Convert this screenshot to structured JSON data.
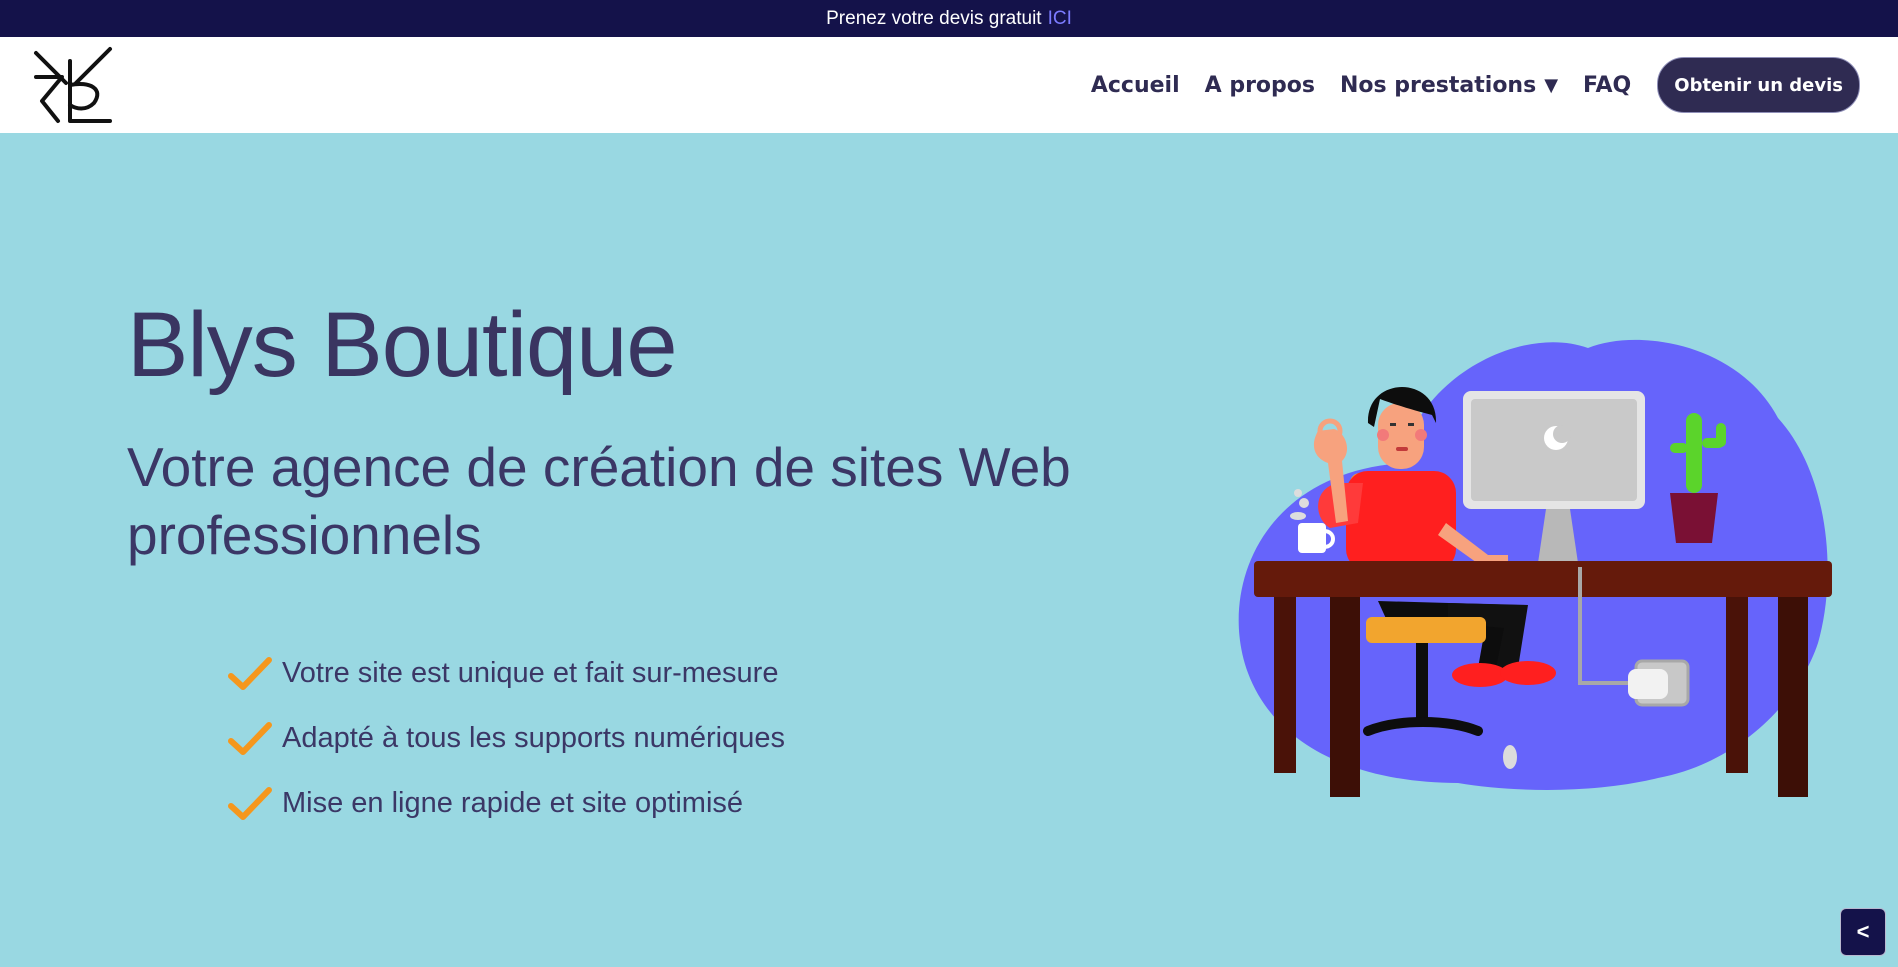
{
  "topbar": {
    "text": "Prenez votre devis gratuit",
    "link": "ICI"
  },
  "nav": {
    "items": [
      "Accueil",
      "A propos",
      "Nos prestations",
      "FAQ"
    ],
    "dropdown_caret": "▼",
    "cta": "Obtenir un devis"
  },
  "hero": {
    "title": "Blys Boutique",
    "subtitle": "Votre agence de création de sites Web professionnels",
    "features": [
      "Votre site est unique et fait sur-mesure",
      "Adapté à tous les supports numériques",
      "Mise en ligne rapide et site optimisé"
    ]
  },
  "back_button": "<",
  "colors": {
    "topbar": "#14124a",
    "hero_bg": "#99d8e2",
    "text_dark": "#3a3561",
    "cta_bg": "#2f2b52",
    "check": "#f5971d",
    "blob": "#6664fb"
  },
  "icons": [
    "logo-monogram",
    "check-icon",
    "chevron-left-icon"
  ]
}
